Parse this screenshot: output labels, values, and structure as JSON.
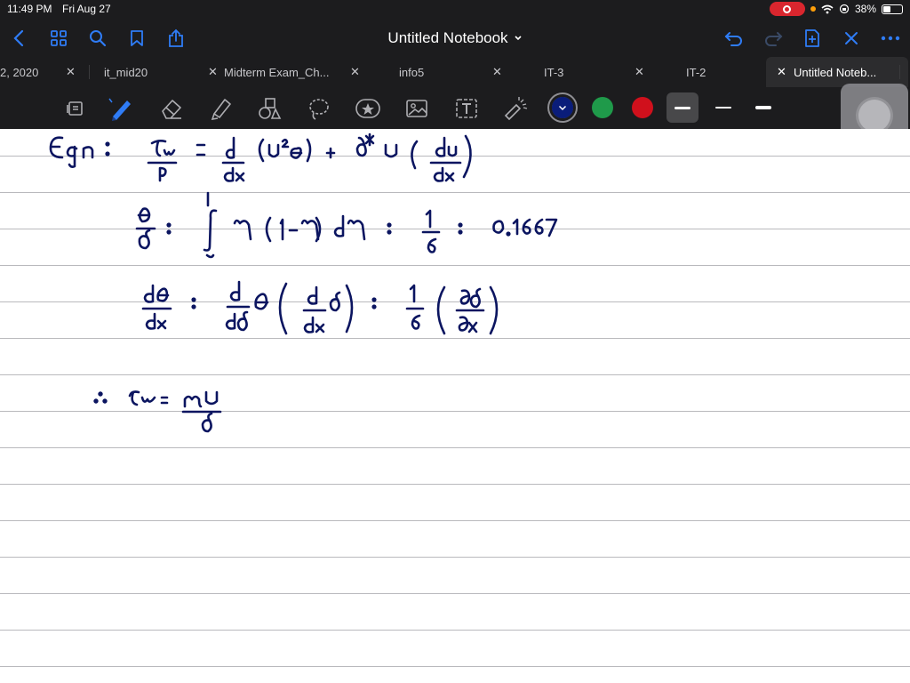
{
  "status": {
    "time": "11:49 PM",
    "date": "Fri Aug 27",
    "battery_text": "38%",
    "battery_level": 0.38
  },
  "nav": {
    "title": "Untitled Notebook",
    "icons": [
      "back-icon",
      "grid-icon",
      "search-icon",
      "bookmark-icon",
      "share-icon",
      "undo-icon",
      "redo-icon",
      "add-page-icon",
      "close-icon",
      "more-icon"
    ]
  },
  "tabs": [
    {
      "label": "2, 2020",
      "active": false
    },
    {
      "label": "it_mid20",
      "active": false
    },
    {
      "label": "Midterm Exam_Ch...",
      "active": false
    },
    {
      "label": "info5",
      "active": false
    },
    {
      "label": "IT-3",
      "active": false
    },
    {
      "label": "IT-2",
      "active": false
    },
    {
      "label": "Untitled Noteb...",
      "active": true
    }
  ],
  "toolbar": {
    "tools": [
      "read-mode-icon",
      "pen-icon",
      "eraser-icon",
      "highlighter-icon",
      "shapes-icon",
      "lasso-icon",
      "sticker-icon",
      "image-icon",
      "text-icon",
      "laser-pointer-icon"
    ],
    "colors": [
      {
        "name": "navy",
        "hex": "#0a1d7a",
        "selected": true
      },
      {
        "name": "green",
        "hex": "#1f9a4a",
        "selected": false
      },
      {
        "name": "red",
        "hex": "#d0101c",
        "selected": false
      }
    ],
    "widths": [
      "thick",
      "thin",
      "medium"
    ],
    "selected_width": "thick"
  },
  "handwriting": {
    "ink_color": "#0b1560",
    "line1": "Eqn : τw/ρ = d/dx (U²θ) + δ* U (dU/dx)",
    "line2": "θ/δ = ∫₀¹ η (1-η) dη = 1/6 = 0.1667",
    "line3": "dθ/dx = d/dδ θ ( d/dx δ ) = 1/6 ( ∂δ/∂x )",
    "line4": "∴ τw = μU/δ"
  }
}
